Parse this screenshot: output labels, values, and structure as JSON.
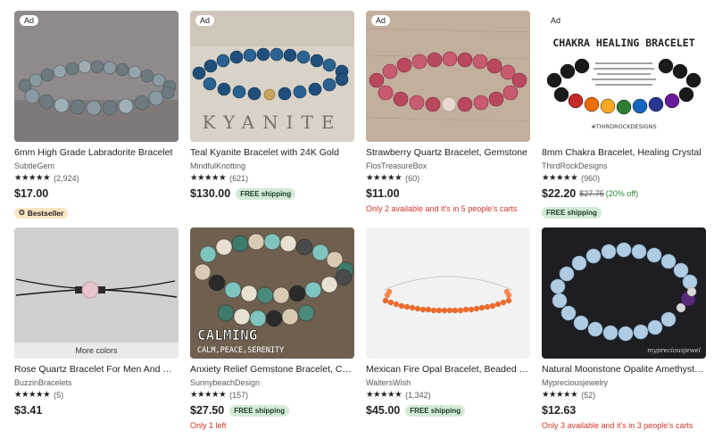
{
  "listings": [
    {
      "ad": "Ad",
      "title": "6mm High Grade Labradorite Bracelet",
      "shop": "SubtleGem",
      "stars": "★★★★★",
      "reviews": "(2,924)",
      "price": "$17.00",
      "badge": "Bestseller"
    },
    {
      "ad": "Ad",
      "title": "Teal Kyanite Bracelet with 24K Gold",
      "shop": "MindfulKnotting",
      "stars": "★★★★★",
      "reviews": "(621)",
      "price": "$130.00",
      "shipping": "FREE shipping",
      "image_text": "KYANITE"
    },
    {
      "ad": "Ad",
      "title": "Strawberry Quartz Bracelet, Gemstone",
      "shop": "FlosTreasureBox",
      "stars": "★★★★★",
      "reviews": "(60)",
      "price": "$11.00",
      "note": "Only 2 available and it's in 5 people's carts"
    },
    {
      "ad": "Ad",
      "title": "8mm Chakra Bracelet, Healing Crystal",
      "shop": "ThirdRockDesigns",
      "stars": "★★★★★",
      "reviews": "(960)",
      "price": "$22.20",
      "original_price": "$27.75",
      "discount": "(20% off)",
      "shipping": "FREE shipping",
      "image_text": "CHAKRA HEALING BRACELET",
      "image_tag": "#THIRDROCKDESIGNS"
    },
    {
      "title": "Rose Quartz Bracelet For Men And Women",
      "shop": "BuzzinBracelets",
      "stars": "★★★★★",
      "reviews": "(5)",
      "price": "$3.41",
      "overlay": "More colors"
    },
    {
      "title": "Anxiety Relief Gemstone Bracelet, Calming",
      "shop": "SunnybeachDesign",
      "stars": "★★★★★",
      "reviews": "(157)",
      "price": "$27.50",
      "shipping": "FREE shipping",
      "note": "Only 1 left",
      "image_text": "CALMING",
      "image_sub": "CALM,PEACE,SERENITY"
    },
    {
      "title": "Mexican Fire Opal Bracelet, Beaded Bracelet",
      "shop": "WaltersWish",
      "stars": "★★★★★",
      "reviews": "(1,342)",
      "price": "$45.00",
      "shipping": "FREE shipping"
    },
    {
      "title": "Natural Moonstone Opalite Amethyst Bracelet",
      "shop": "Mypreciousjewelry",
      "stars": "★★★★★",
      "reviews": "(52)",
      "price": "$12.63",
      "note": "Only 3 available and it's in 3 people's carts",
      "image_tag": "mypreciousjewel"
    }
  ],
  "colors": {
    "free_shipping_bg": "#d4e9d7",
    "bestseller_bg": "#fbe4c4",
    "urgency": "#d0372b",
    "discount": "#258635"
  }
}
